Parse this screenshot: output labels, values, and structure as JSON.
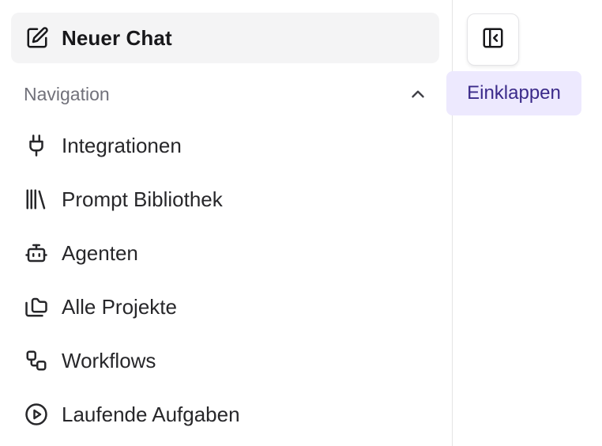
{
  "sidebar": {
    "new_chat": {
      "label": "Neuer Chat",
      "icon": "pencil-square-icon"
    },
    "section": {
      "label": "Navigation",
      "icon": "chevron-up-icon",
      "expanded": true
    },
    "items": [
      {
        "label": "Integrationen",
        "icon": "plug-icon"
      },
      {
        "label": "Prompt Bibliothek",
        "icon": "library-icon"
      },
      {
        "label": "Agenten",
        "icon": "bot-icon"
      },
      {
        "label": "Alle Projekte",
        "icon": "folders-icon"
      },
      {
        "label": "Workflows",
        "icon": "workflow-icon"
      },
      {
        "label": "Laufende Aufgaben",
        "icon": "play-circle-icon"
      }
    ]
  },
  "collapse": {
    "icon": "panel-left-close-icon",
    "tooltip": "Einklappen"
  },
  "colors": {
    "new_chat_bg": "#f4f4f5",
    "tooltip_bg": "#ede9fe",
    "tooltip_text": "#3b2a8a",
    "section_label": "#71717a"
  }
}
